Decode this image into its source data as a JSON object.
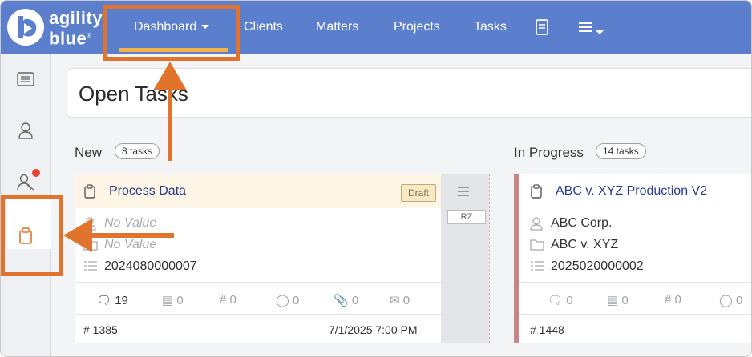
{
  "brand": {
    "logo_line1": "agility",
    "logo_line2": "blue",
    "logo_mark": "®"
  },
  "nav": {
    "items": [
      {
        "label": "Dashboard",
        "has_caret": true,
        "active": true
      },
      {
        "label": "Clients"
      },
      {
        "label": "Matters"
      },
      {
        "label": "Projects"
      },
      {
        "label": "Tasks"
      }
    ],
    "extra_icons": [
      "document-icon",
      "hamburger-menu-icon"
    ]
  },
  "sidebar": {
    "items": [
      {
        "icon": "list-icon"
      },
      {
        "icon": "user-icon"
      },
      {
        "icon": "team-icon",
        "has_notification": true
      },
      {
        "icon": "clipboard-icon",
        "active": true
      }
    ]
  },
  "page": {
    "title": "Open Tasks"
  },
  "columns": [
    {
      "title": "New",
      "count_label": "8 tasks",
      "card": {
        "title": "Process Data",
        "badge": "Draft",
        "assignee_initials": "RZ",
        "client": "No Value",
        "matter": "No Value",
        "reference": "2024080000007",
        "stats": {
          "comments": "19",
          "storage": "0",
          "number": "0",
          "billing": "0",
          "attachments": "0",
          "mail": "0"
        },
        "task_number": "# 1385",
        "due": "7/1/2025 7:00 PM"
      }
    },
    {
      "title": "In Progress",
      "count_label": "14 tasks",
      "card": {
        "title": "ABC v. XYZ Production V2",
        "client": "ABC Corp.",
        "matter": "ABC v. XYZ",
        "reference": "2025020000002",
        "stats": {
          "comments": "0",
          "storage": "0",
          "number": "0",
          "billing": "0"
        },
        "task_number": "# 1448"
      }
    }
  ],
  "colors": {
    "nav_bg": "#5b7fcc",
    "active_underline": "#f3b34a",
    "annotation_orange": "#e0742c",
    "link_navy": "#2a3a8c",
    "notification_red": "#e8452f"
  }
}
